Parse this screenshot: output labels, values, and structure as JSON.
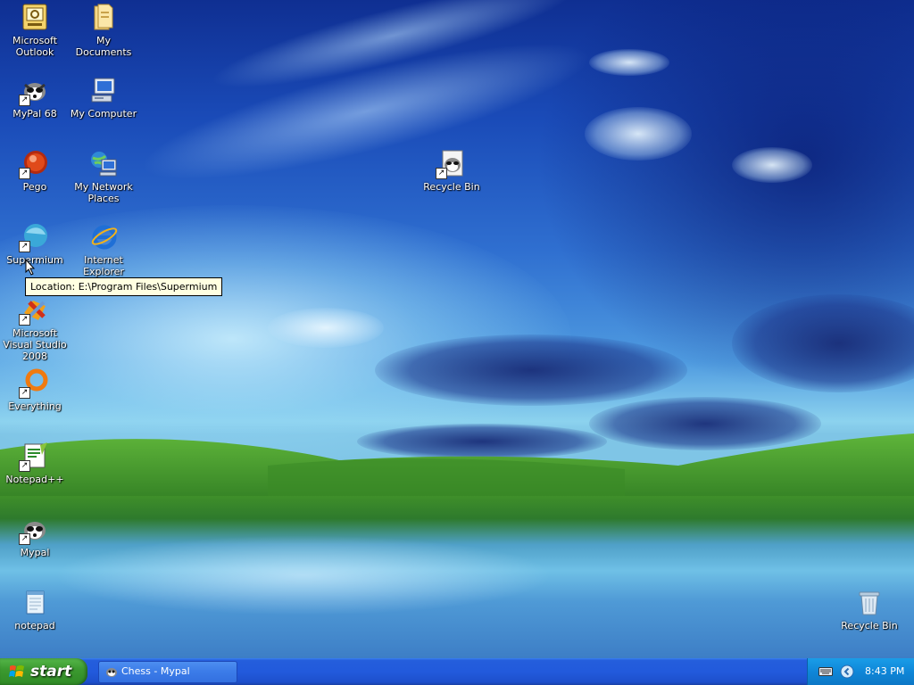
{
  "desktop_icons": [
    {
      "name": "Microsoft Outlook",
      "shortcut": false
    },
    {
      "name": "My Documents",
      "shortcut": false
    },
    {
      "name": "MyPal 68",
      "shortcut": true
    },
    {
      "name": "My Computer",
      "shortcut": false
    },
    {
      "name": "Pego",
      "shortcut": true
    },
    {
      "name": "My Network Places",
      "shortcut": false
    },
    {
      "name": "Recycle Bin",
      "shortcut": true
    },
    {
      "name": "Supermium",
      "shortcut": true
    },
    {
      "name": "Internet Explorer",
      "shortcut": false
    },
    {
      "name": "Microsoft Visual Studio 2008",
      "shortcut": true
    },
    {
      "name": "Everything",
      "shortcut": true
    },
    {
      "name": "Notepad++",
      "shortcut": true
    },
    {
      "name": "Mypal",
      "shortcut": true
    },
    {
      "name": "notepad",
      "shortcut": false
    },
    {
      "name": "Recycle Bin",
      "shortcut": false
    }
  ],
  "tooltip": "Location: E:\\Program Files\\Supermium",
  "taskbar": {
    "start_label": "start",
    "task_button_label": "Chess - Mypal",
    "clock": "8:43 PM"
  },
  "colors": {
    "taskbar_blue": "#245edc",
    "start_green": "#3c9a30",
    "tray_blue": "#0f87d8",
    "tooltip_bg": "#ffffe1"
  }
}
